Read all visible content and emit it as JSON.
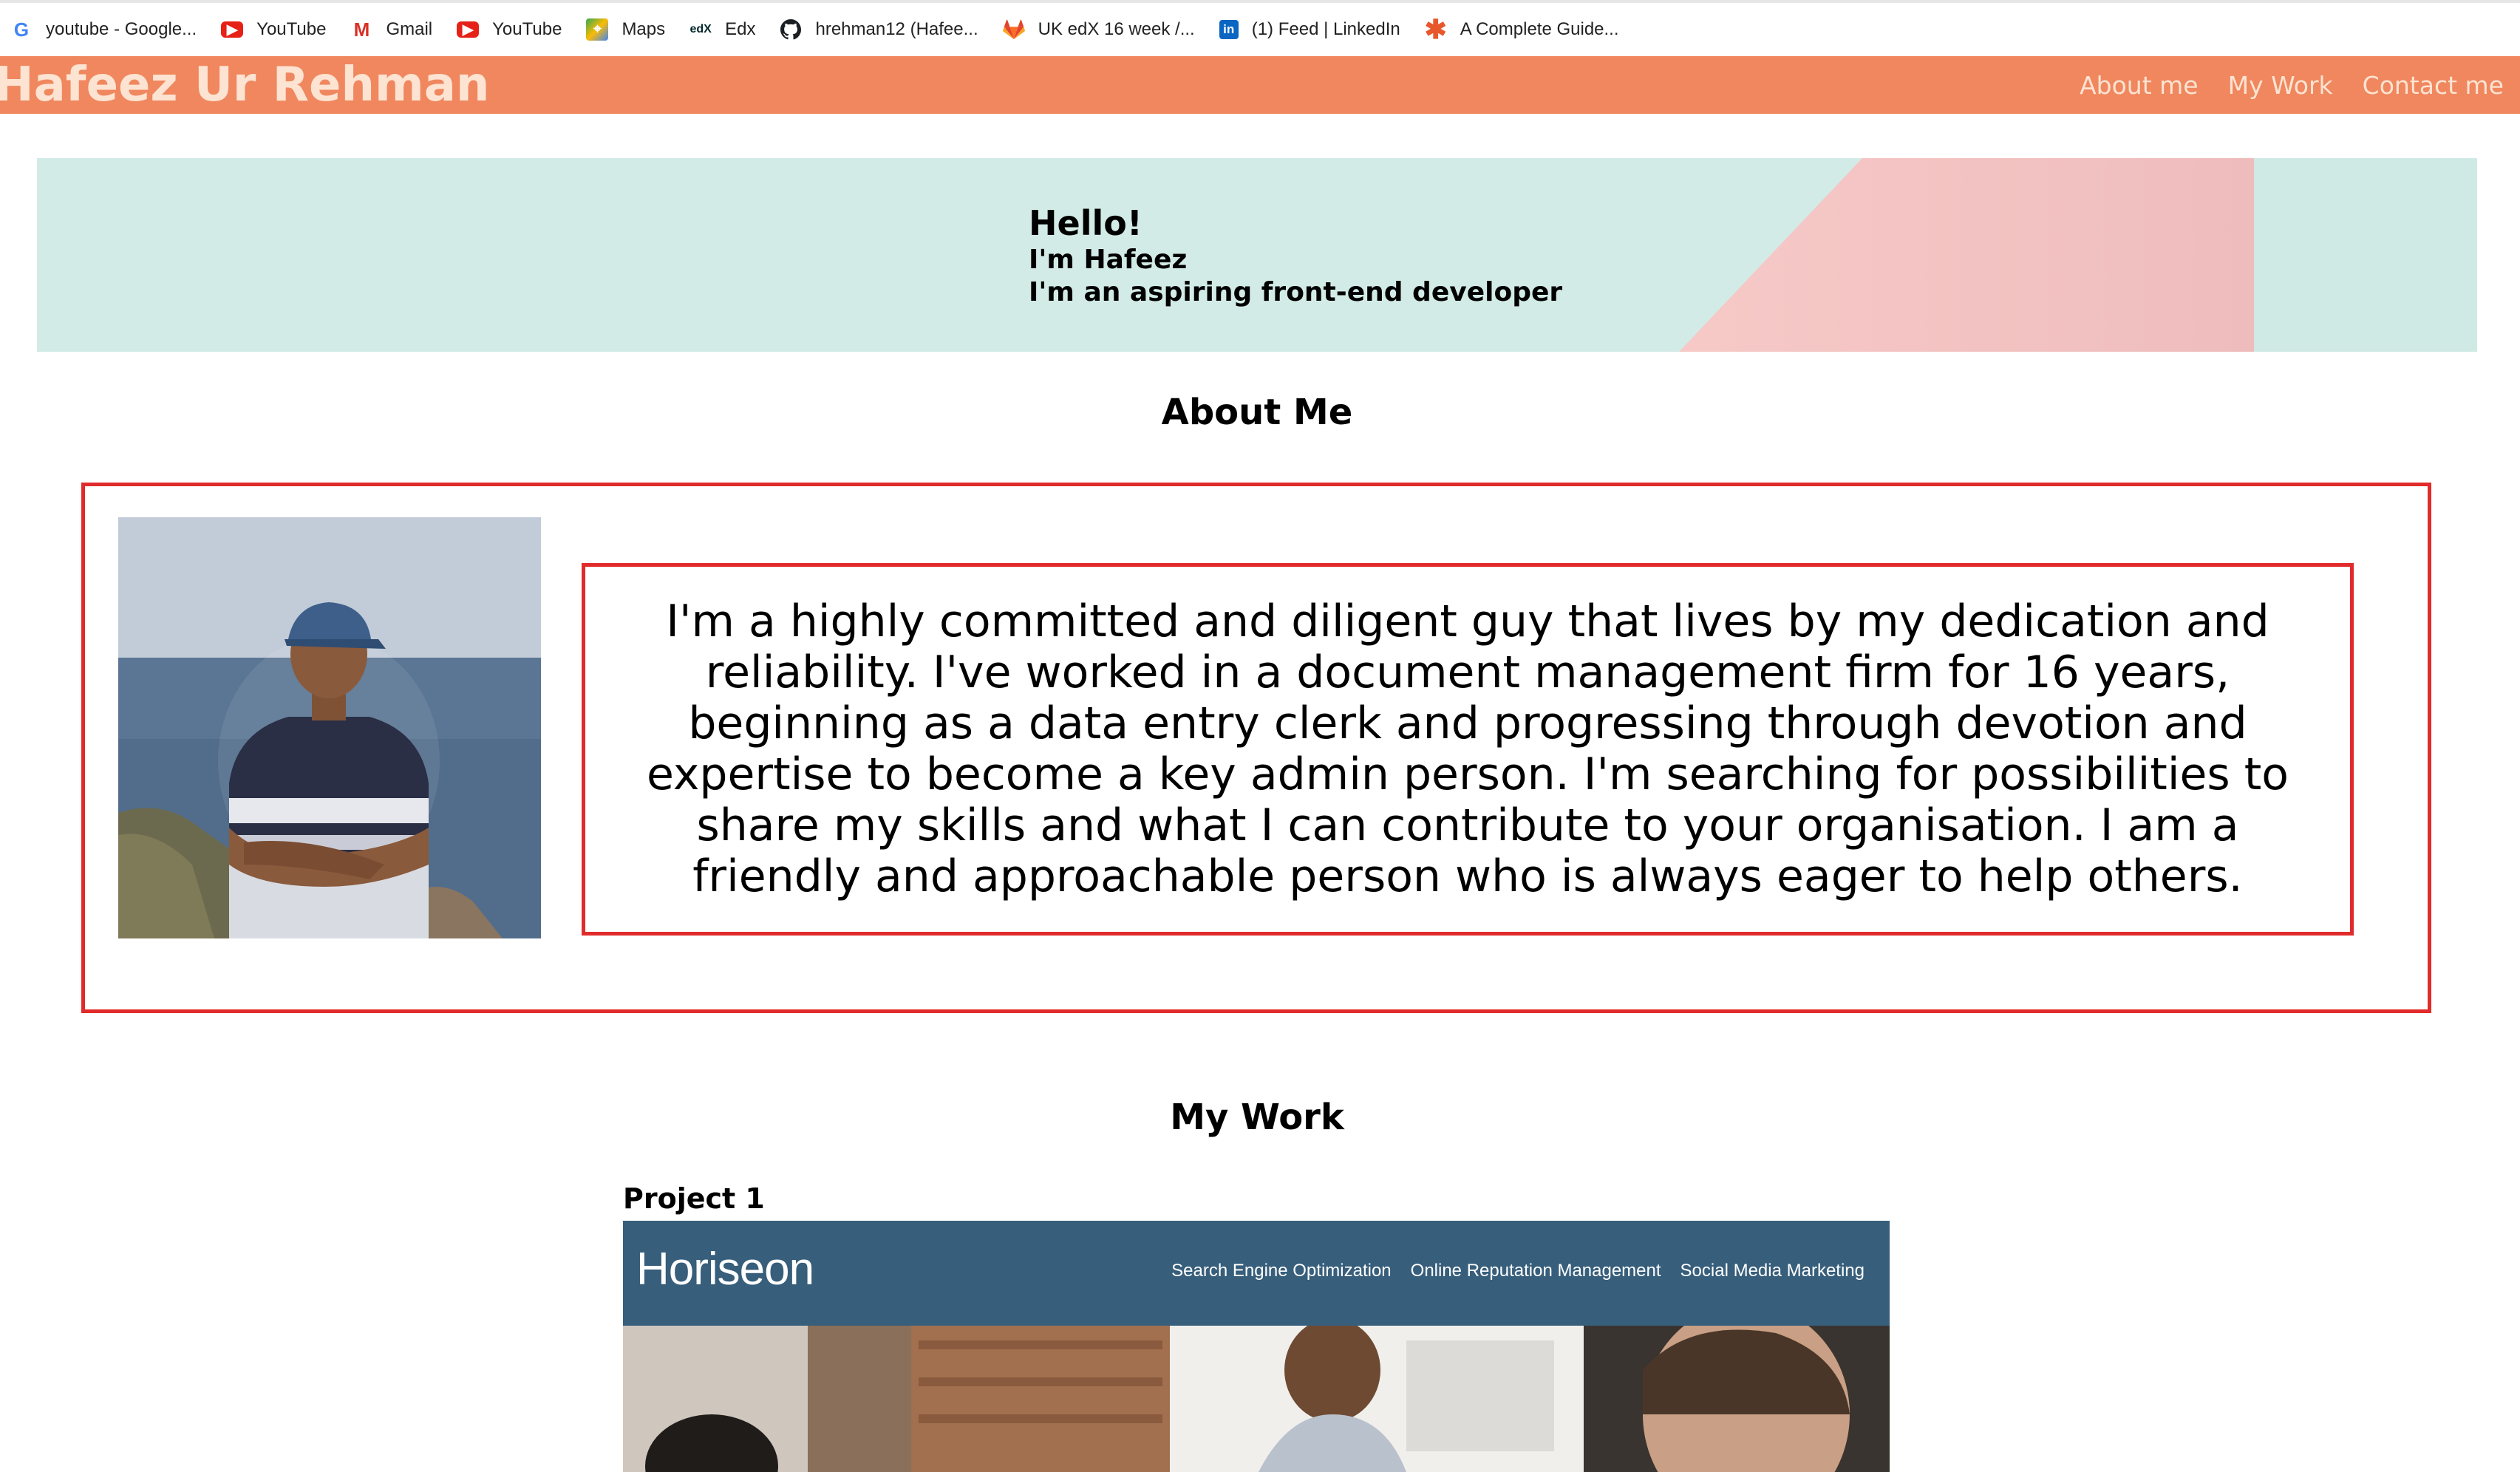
{
  "bookmarks": [
    {
      "label": "youtube - Google...",
      "icon": "google-icon"
    },
    {
      "label": "YouTube",
      "icon": "youtube-icon"
    },
    {
      "label": "Gmail",
      "icon": "gmail-icon"
    },
    {
      "label": "YouTube",
      "icon": "youtube-icon"
    },
    {
      "label": "Maps",
      "icon": "maps-icon"
    },
    {
      "label": "Edx",
      "icon": "edx-icon"
    },
    {
      "label": "hrehman12 (Hafee...",
      "icon": "github-icon"
    },
    {
      "label": "UK edX 16 week /...",
      "icon": "gitlab-icon"
    },
    {
      "label": "(1) Feed | LinkedIn",
      "icon": "linkedin-icon"
    },
    {
      "label": "A Complete Guide...",
      "icon": "asterisk-icon"
    }
  ],
  "nav": {
    "brand": "Hafeez Ur Rehman",
    "links": [
      "About me",
      "My Work",
      "Contact me"
    ]
  },
  "hero": {
    "greeting": "Hello!",
    "line1": "I'm Hafeez",
    "line2": "I'm an aspiring front-end developer"
  },
  "about": {
    "title": "About Me",
    "text": "I'm a highly committed and diligent guy that lives by my dedication and reliability. I've worked in a document management firm for 16 years, beginning as a data entry clerk and progressing through devotion and expertise to become a key admin person. I'm searching for possibilities to share my skills and what I can contribute to your organisation. I am a friendly and approachable person who is always eager to help others."
  },
  "work": {
    "title": "My Work",
    "projects": [
      {
        "label": "Project 1",
        "site_name": "Horiseon",
        "site_nav": [
          "Search Engine Optimization",
          "Online Reputation Management",
          "Social Media Marketing"
        ]
      }
    ]
  },
  "colors": {
    "nav_bg": "#f0875e",
    "nav_text": "#fde3d2",
    "hero_bg": "#d3ebe6",
    "hero_accent": "#f2c0c0",
    "border_red": "#e12b2b",
    "project_header": "#375e7b"
  }
}
